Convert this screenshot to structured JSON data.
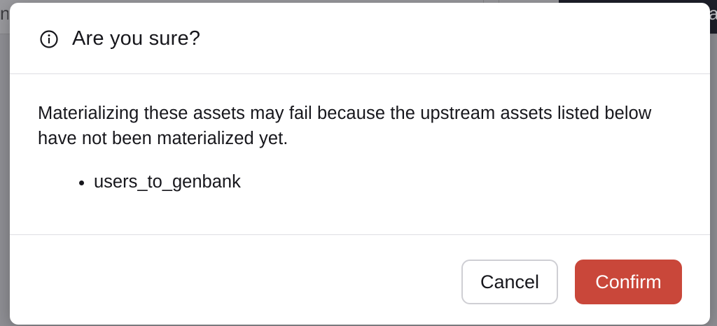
{
  "background": {
    "left_text": "n",
    "right_button_text": "a"
  },
  "dialog": {
    "title": "Are you sure?",
    "title_icon": "info-icon",
    "message": "Materializing these assets may fail because the upstream assets listed below have not been materialized yet.",
    "assets": [
      "users_to_genbank"
    ],
    "cancel_label": "Cancel",
    "confirm_label": "Confirm"
  },
  "colors": {
    "confirm_bg": "#c9473a",
    "text": "#17171c",
    "overlay": "#8f8f94"
  }
}
